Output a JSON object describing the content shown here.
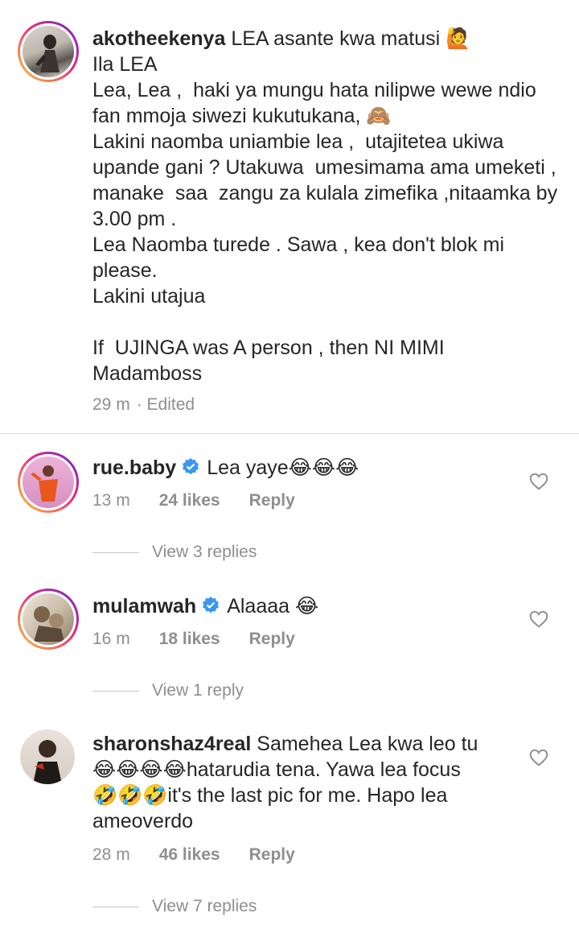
{
  "caption": {
    "username": "akotheekenya",
    "text_first": "LEA asante kwa matusi ",
    "emoji_first": "🙋",
    "body": "Ila LEA\nLea, Lea ,  haki ya mungu hata nilipwe wewe ndio fan mmoja siwezi kukutukana, 🙈\nLakini naomba uniambie lea ,  utajitetea ukiwa upande gani ? Utakuwa  umesimama ama umeketi , manake  saa  zangu za kulala zimefika ,nitaamka by 3.00 pm .\nLea Naomba turede . Sawa , kea don't blok mi please.\nLakini utajua\n\nIf  UJINGA was A person , then NI MIMI Madamboss",
    "time": "29 m",
    "edited": "· Edited"
  },
  "comments": [
    {
      "username": "rue.baby",
      "verified": true,
      "text": "Lea yaye",
      "emojis": "😂😂😂",
      "time": "13 m",
      "likes": "24 likes",
      "reply": "Reply",
      "view_replies": "View 3 replies"
    },
    {
      "username": "mulamwah",
      "verified": true,
      "text": "Alaaaa ",
      "emojis": "😂",
      "time": "16 m",
      "likes": "18 likes",
      "reply": "Reply",
      "view_replies": "View 1 reply"
    },
    {
      "username": "sharonshaz4real",
      "verified": false,
      "text_line1": "Samehea Lea kwa leo tu",
      "text_line2_emojis": "😂😂😂😂",
      "text_line2": "hatarudia tena. Yawa lea focus",
      "text_line3_emojis": "🤣🤣🤣",
      "text_line3": "it's the last pic for me. Hapo lea",
      "text_line4": "ameoverdo",
      "time": "28 m",
      "likes": "46 likes",
      "reply": "Reply",
      "view_replies": "View 7 replies"
    }
  ],
  "icons": {
    "like": "heart-outline-icon",
    "verified": "verified-badge-icon"
  },
  "colors": {
    "verified_blue": "#3897f0",
    "meta_gray": "#8e8e8e",
    "text": "#262626"
  }
}
